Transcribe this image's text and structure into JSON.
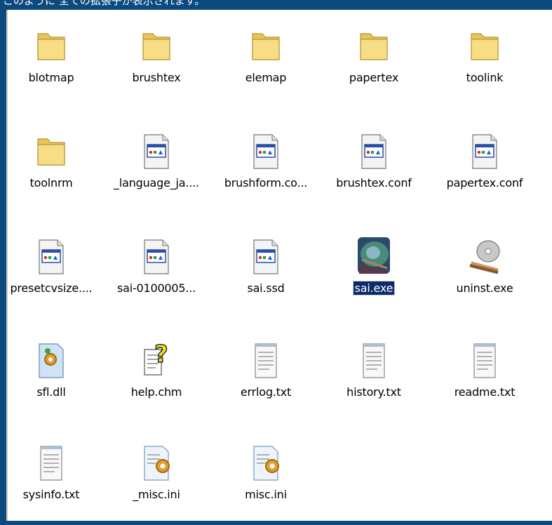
{
  "caption": "このように 全ての拡張子が表示されます。",
  "items": [
    {
      "label": "blotmap",
      "icon": "folder-icon"
    },
    {
      "label": "brushtex",
      "icon": "folder-icon"
    },
    {
      "label": "elemap",
      "icon": "folder-icon"
    },
    {
      "label": "papertex",
      "icon": "folder-icon"
    },
    {
      "label": "toolink",
      "icon": "folder-icon"
    },
    {
      "label": "toolnrm",
      "icon": "folder-icon"
    },
    {
      "label": "_language_ja....",
      "icon": "app-file-icon"
    },
    {
      "label": "brushform.co...",
      "icon": "app-file-icon"
    },
    {
      "label": "brushtex.conf",
      "icon": "app-file-icon"
    },
    {
      "label": "papertex.conf",
      "icon": "app-file-icon"
    },
    {
      "label": "presetcvsize....",
      "icon": "app-file-icon"
    },
    {
      "label": "sai-0100005...",
      "icon": "app-file-icon"
    },
    {
      "label": "sai.ssd",
      "icon": "app-file-icon"
    },
    {
      "label": "sai.exe",
      "icon": "sai-app-icon",
      "selected": true
    },
    {
      "label": "uninst.exe",
      "icon": "uninstall-cd-icon"
    },
    {
      "label": "sfl.dll",
      "icon": "dll-gear-icon"
    },
    {
      "label": "help.chm",
      "icon": "help-file-icon"
    },
    {
      "label": "errlog.txt",
      "icon": "text-file-icon"
    },
    {
      "label": "history.txt",
      "icon": "text-file-icon"
    },
    {
      "label": "readme.txt",
      "icon": "text-file-icon"
    },
    {
      "label": "sysinfo.txt",
      "icon": "text-file-icon"
    },
    {
      "label": "_misc.ini",
      "icon": "ini-gear-icon"
    },
    {
      "label": "misc.ini",
      "icon": "ini-gear-icon"
    }
  ]
}
